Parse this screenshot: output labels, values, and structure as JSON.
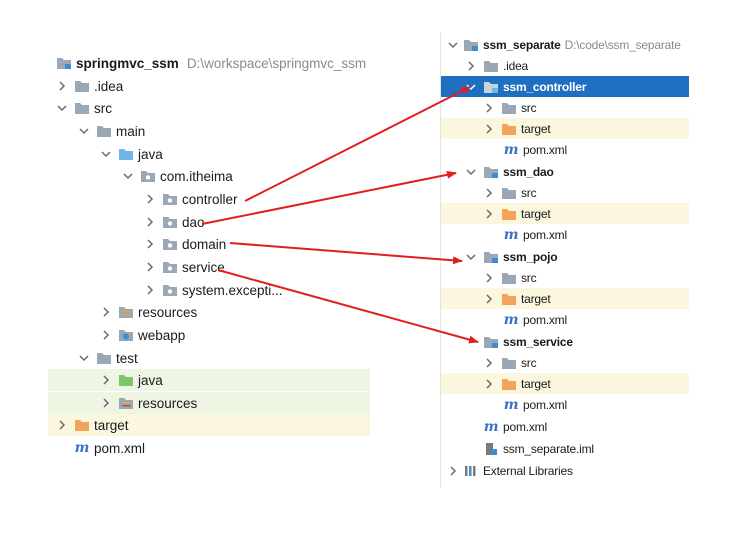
{
  "left_tree": {
    "root": {
      "name": "springmvc_ssm",
      "path": "D:\\workspace\\springmvc_ssm"
    },
    "items": [
      {
        "label": ".idea"
      },
      {
        "label": "src"
      },
      {
        "label": "main"
      },
      {
        "label": "java"
      },
      {
        "label": "com.itheima"
      },
      {
        "label": "controller"
      },
      {
        "label": "dao"
      },
      {
        "label": "domain"
      },
      {
        "label": "service"
      },
      {
        "label": "system.excepti..."
      },
      {
        "label": "resources"
      },
      {
        "label": "webapp"
      },
      {
        "label": "test"
      },
      {
        "label": "java"
      },
      {
        "label": "resources"
      },
      {
        "label": "target"
      },
      {
        "label": "pom.xml"
      }
    ]
  },
  "right_tree": {
    "root": {
      "name": "ssm_separate",
      "path": "D:\\code\\ssm_separate"
    },
    "items": [
      {
        "label": ".idea"
      },
      {
        "label": "ssm_controller"
      },
      {
        "label": "src"
      },
      {
        "label": "target"
      },
      {
        "label": "pom.xml"
      },
      {
        "label": "ssm_dao"
      },
      {
        "label": "src"
      },
      {
        "label": "target"
      },
      {
        "label": "pom.xml"
      },
      {
        "label": "ssm_pojo"
      },
      {
        "label": "src"
      },
      {
        "label": "target"
      },
      {
        "label": "pom.xml"
      },
      {
        "label": "ssm_service"
      },
      {
        "label": "src"
      },
      {
        "label": "target"
      },
      {
        "label": "pom.xml"
      },
      {
        "label": "pom.xml"
      },
      {
        "label": "ssm_separate.iml"
      },
      {
        "label": "External Libraries"
      }
    ]
  },
  "colors": {
    "arrow": "#e02020",
    "selected": "#1f6fc1",
    "folder_gray": "#9aa7b4",
    "folder_blue": "#6fb7e6",
    "folder_green": "#7fc36a",
    "folder_orange": "#f2a45a",
    "module_blue": "#3b8ed6"
  }
}
